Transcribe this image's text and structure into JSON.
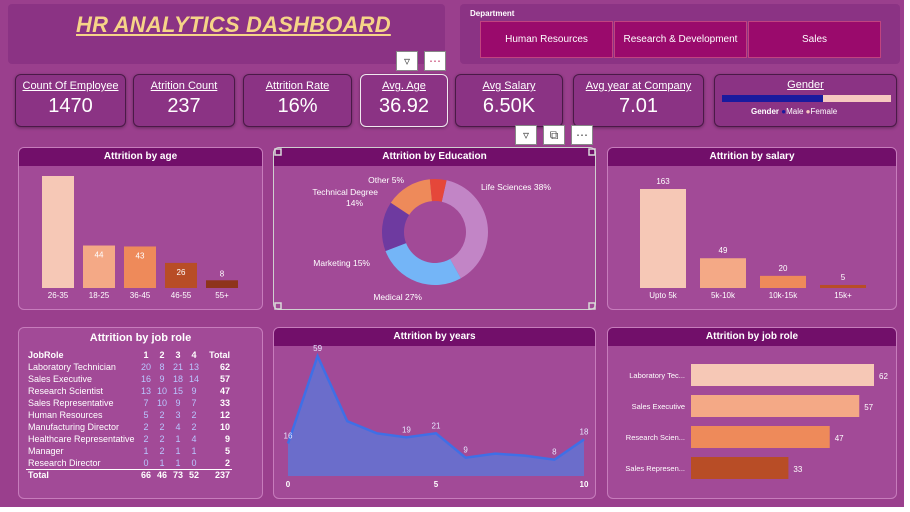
{
  "title": "HR ANALYTICS DASHBOARD",
  "department": {
    "label": "Department",
    "options": [
      "Human Resources",
      "Research & Development",
      "Sales"
    ]
  },
  "kpis": [
    {
      "label": "Count Of Employee",
      "value": "1470"
    },
    {
      "label": "Atrition Count",
      "value": "237"
    },
    {
      "label": "Attrition Rate",
      "value": "16%"
    },
    {
      "label": "Avg. Age",
      "value": "36.92"
    },
    {
      "label": "Avg Salary",
      "value": "6.50K"
    },
    {
      "label": "Avg year at Company",
      "value": "7.01"
    }
  ],
  "gender": {
    "title": "Gender",
    "legend_title": "Gender",
    "male_label": "Male",
    "female_label": "Female",
    "male_fraction": 0.6,
    "colors": {
      "male": "#1a1a9e",
      "female": "#f6c8c0"
    }
  },
  "colors": {
    "bar_scale": [
      "#f6c8b6",
      "#f4a986",
      "#ee8a5a",
      "#b84d26",
      "#8e341c"
    ],
    "donut": [
      "#c285c6",
      "#74b5f7",
      "#6e3aa0",
      "#ee8a5a",
      "#e5473a"
    ],
    "area_fill": "#5e76d8",
    "area_line": "#3f6fe6",
    "header": "#720f6a"
  },
  "panels": {
    "age_title": "Attrition by age",
    "education_title": "Attrition by Education",
    "salary_title": "Attrition by salary",
    "jobrole_table_title": "Attrition by job role",
    "years_title": "Attrition by years",
    "jobrole_bar_title": "Attrition by job role"
  },
  "chart_data": [
    {
      "type": "bar",
      "title": "Attrition by age",
      "categories": [
        "26-35",
        "18-25",
        "36-45",
        "46-55",
        "55+"
      ],
      "values": [
        116,
        44,
        43,
        26,
        8
      ],
      "ylim": [
        0,
        116
      ]
    },
    {
      "type": "pie",
      "title": "Attrition by Education",
      "categories": [
        "Life Sciences",
        "Medical",
        "Marketing",
        "Technical Degree",
        "Other"
      ],
      "values": [
        38,
        27,
        15,
        14,
        5
      ],
      "labels": [
        "Life Sciences 38%",
        "Medical 27%",
        "Marketing 15%",
        "Technical Degree 14%",
        "Other 5%"
      ]
    },
    {
      "type": "bar",
      "title": "Attrition by salary",
      "categories": [
        "Upto 5k",
        "5k-10k",
        "10k-15k",
        "15k+"
      ],
      "values": [
        163,
        49,
        20,
        5
      ],
      "ylim": [
        0,
        163
      ]
    },
    {
      "type": "table",
      "title": "Attrition by job role",
      "columns": [
        "JobRole",
        "1",
        "2",
        "3",
        "4",
        "Total"
      ],
      "rows": [
        [
          "Laboratory Technician",
          "20",
          "8",
          "21",
          "13",
          "62"
        ],
        [
          "Sales Executive",
          "16",
          "9",
          "18",
          "14",
          "57"
        ],
        [
          "Research Scientist",
          "13",
          "10",
          "15",
          "9",
          "47"
        ],
        [
          "Sales Representative",
          "7",
          "10",
          "9",
          "7",
          "33"
        ],
        [
          "Human Resources",
          "5",
          "2",
          "3",
          "2",
          "12"
        ],
        [
          "Manufacturing Director",
          "2",
          "2",
          "4",
          "2",
          "10"
        ],
        [
          "Healthcare Representative",
          "2",
          "2",
          "1",
          "4",
          "9"
        ],
        [
          "Manager",
          "1",
          "2",
          "1",
          "1",
          "5"
        ],
        [
          "Research Director",
          "0",
          "1",
          "1",
          "0",
          "2"
        ]
      ],
      "total": [
        "Total",
        "66",
        "46",
        "73",
        "52",
        "237"
      ]
    },
    {
      "type": "area",
      "title": "Attrition by years",
      "x": [
        0,
        1,
        2,
        3,
        4,
        5,
        6,
        7,
        8,
        9,
        10
      ],
      "y": [
        16,
        59,
        27,
        21,
        19,
        21,
        9,
        11,
        10,
        8,
        18
      ],
      "data_labels": {
        "0": 16,
        "1": 59,
        "4": 19,
        "5": 21,
        "6": 9,
        "9": 8,
        "10": 18
      },
      "xticks": [
        0,
        5,
        10
      ],
      "ylim": [
        0,
        62
      ]
    },
    {
      "type": "bar",
      "orientation": "horizontal",
      "title": "Attrition by job role",
      "categories": [
        "Laboratory Tec...",
        "Sales Executive",
        "Research Scien...",
        "Sales Represen..."
      ],
      "values": [
        62,
        57,
        47,
        33
      ],
      "xlim": [
        0,
        62
      ]
    }
  ]
}
